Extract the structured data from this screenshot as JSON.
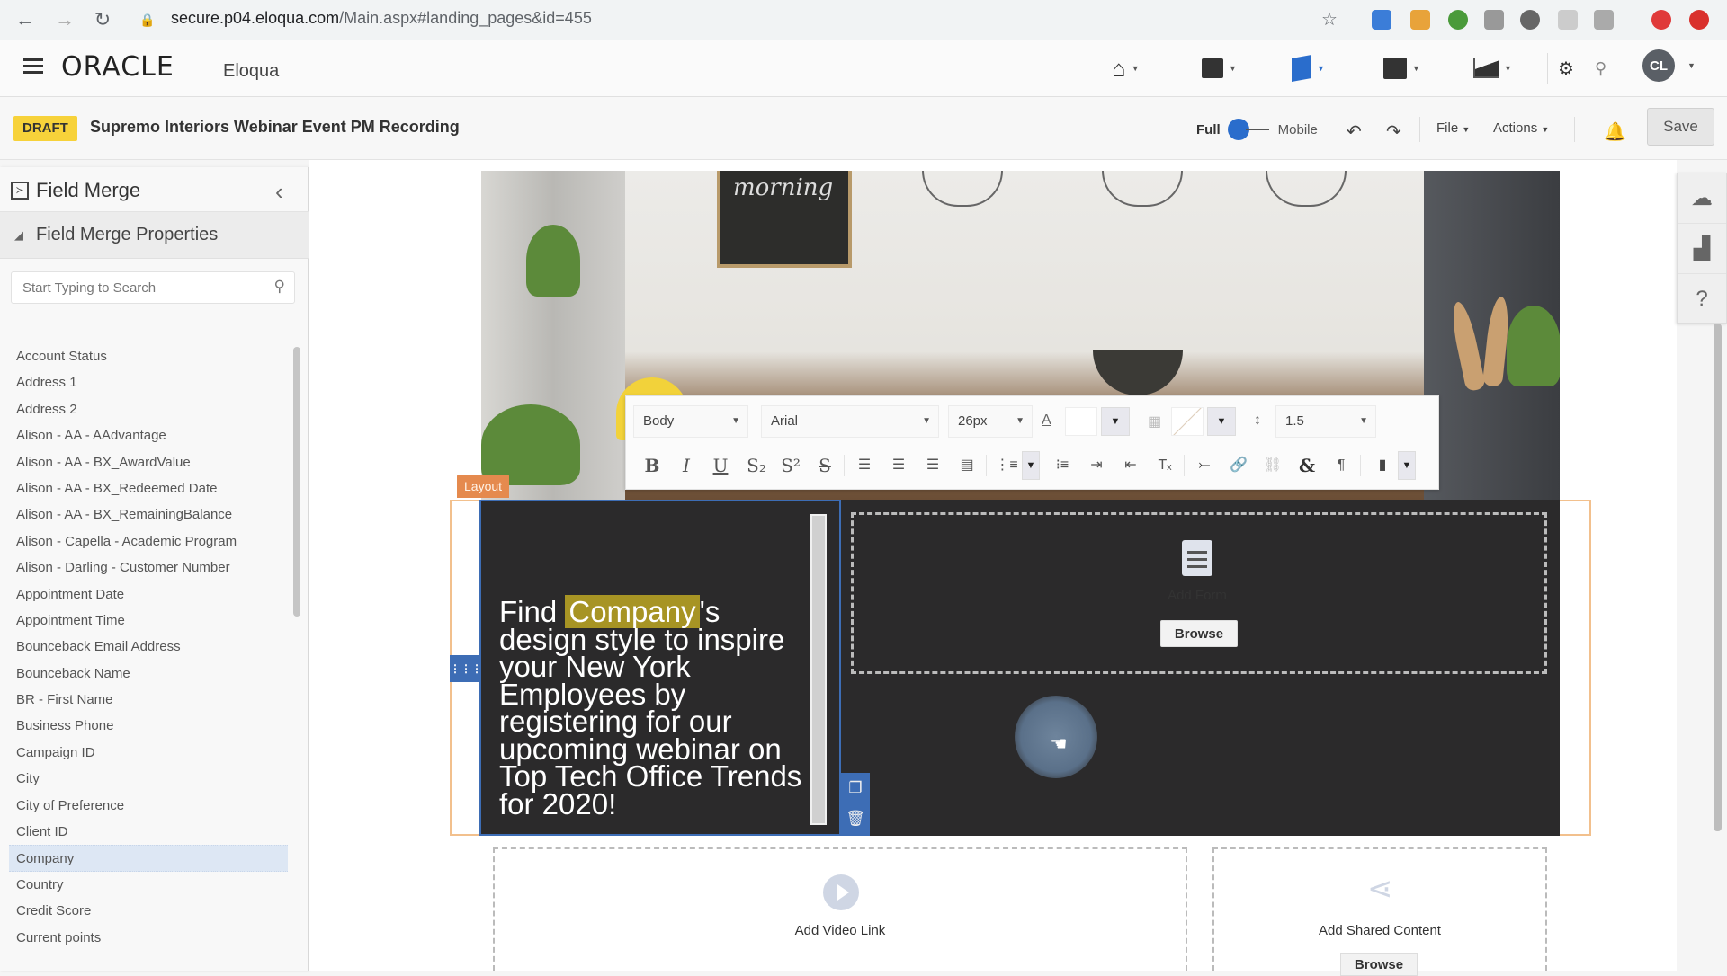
{
  "browser": {
    "url_host": "secure.p04.eloqua.com",
    "url_path": "/Main.aspx#landing_pages&id=455"
  },
  "app": {
    "logo_brand": "ORACLE",
    "logo_product": "Eloqua",
    "nav_icons": [
      "home-icon",
      "assets-icon",
      "editor-icon",
      "contacts-icon",
      "analytics-icon"
    ],
    "avatar_initials": "CL"
  },
  "titlebar": {
    "status_badge": "DRAFT",
    "page_title": "Supremo Interiors Webinar Event PM Recording",
    "view_full": "Full",
    "view_mobile": "Mobile",
    "file_menu": "File",
    "actions_menu": "Actions",
    "save_label": "Save"
  },
  "sidebar": {
    "title": "Field Merge",
    "section_title": "Field Merge Properties",
    "search_placeholder": "Start Typing to Search",
    "selected": "Company",
    "items": [
      "Account Status",
      "Address 1",
      "Address 2",
      "Alison - AA - AAdvantage",
      "Alison - AA - BX_AwardValue",
      "Alison - AA - BX_Redeemed Date",
      "Alison - AA - BX_RemainingBalance",
      "Alison - Capella - Academic Program",
      "Alison - Darling - Customer Number",
      "Appointment Date",
      "Appointment Time",
      "Bounceback Email Address",
      "Bounceback Name",
      "BR - First Name",
      "Business Phone",
      "Campaign ID",
      "City",
      "City of Preference",
      "Client ID",
      "Company",
      "Country",
      "Credit Score",
      "Current points"
    ]
  },
  "hero": {
    "chalkboard_text": "morning"
  },
  "rte_toolbar": {
    "style_value": "Body",
    "font_value": "Arial",
    "size_value": "26px",
    "line_height_value": "1.5",
    "buttons": [
      "B",
      "I",
      "U",
      "S₂",
      "S²",
      "S"
    ]
  },
  "layout": {
    "tag": "Layout",
    "text_before": "Find ",
    "merge_field": "Company",
    "text_after": "'s design style to inspire your New York Employees by registering for our upcoming webinar on Top Tech Office Trends for 2020!",
    "add_form_label": "Add Form",
    "browse_label": "Browse"
  },
  "bottom": {
    "video_label": "Add Video Link",
    "shared_label": "Add Shared Content",
    "shared_browse": "Browse"
  },
  "colors": {
    "accent_blue": "#3d6db5",
    "draft_yellow": "#f7d23a",
    "layout_orange": "#e58a4e",
    "merge_highlight": "#a79424"
  }
}
